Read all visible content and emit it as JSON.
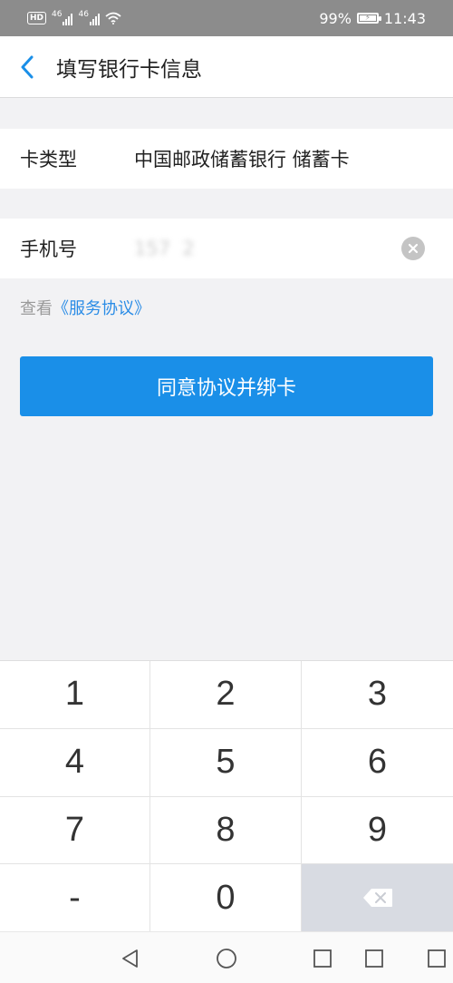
{
  "status_bar": {
    "hd": "HD",
    "network1": "46",
    "network2": "46",
    "battery_percent": "99%",
    "time": "11:43"
  },
  "header": {
    "title": "填写银行卡信息",
    "back_icon": "chevron-left-icon"
  },
  "card_row": {
    "label": "卡类型",
    "value": "中国邮政储蓄银行 储蓄卡"
  },
  "phone_row": {
    "label": "手机号",
    "value": "157  2",
    "clear_icon": "clear-icon"
  },
  "agreement": {
    "prefix": "查看",
    "link": "《服务协议》"
  },
  "submit_button": {
    "label": "同意协议并绑卡"
  },
  "keypad": {
    "keys": [
      "1",
      "2",
      "3",
      "4",
      "5",
      "6",
      "7",
      "8",
      "9",
      "-",
      "0"
    ],
    "delete_icon": "backspace-icon"
  },
  "nav_bar": {
    "icons": [
      "back-triangle-icon",
      "home-circle-icon",
      "recent-square-icon"
    ]
  },
  "colors": {
    "accent": "#1a8fe8",
    "link": "#2a8ce6",
    "background": "#f2f2f4",
    "status_bar": "#8c8c8c"
  }
}
